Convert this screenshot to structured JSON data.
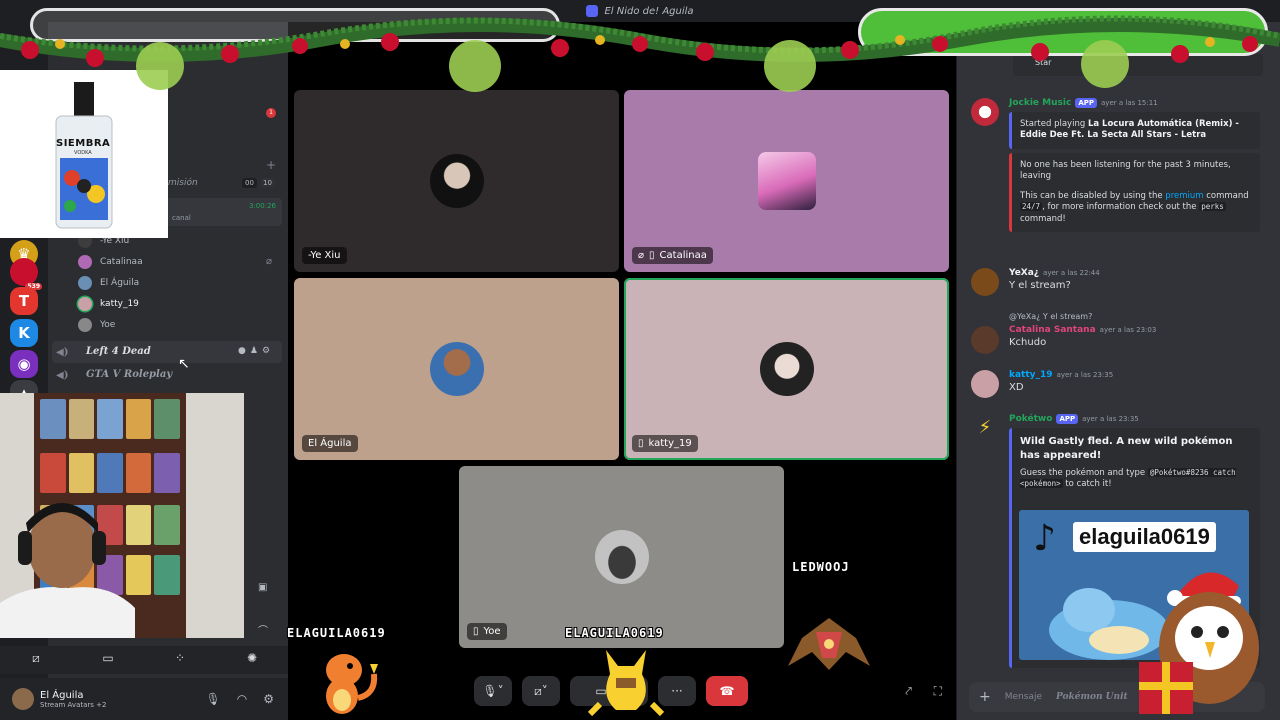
{
  "window": {
    "title": "El Nido de! Aguila"
  },
  "colors": {
    "accent": "#5865f2",
    "speaking": "#23a55a",
    "danger": "#da373c",
    "pink_tile": "#a97bab"
  },
  "sidebar": {
    "channel_partial": "misión",
    "stream_time": "3:00:26",
    "channel_caption": "canal",
    "counter_left": "00",
    "counter_right": "10",
    "notification_count": "1",
    "server_badge": "539",
    "voice_members": [
      {
        "name": "-Ye Xiu"
      },
      {
        "name": "Catalinaa"
      },
      {
        "name": "El Águila"
      },
      {
        "name": "katty_19"
      },
      {
        "name": "Yoe"
      }
    ],
    "voice_channels": [
      {
        "name": "Left 4 Dead"
      },
      {
        "name": "GTA V Roleplay"
      }
    ]
  },
  "product": {
    "brand": "SIEMBRA",
    "sub": "VODKA"
  },
  "user": {
    "name": "El Águila",
    "status": "Stream Avatars +2"
  },
  "tiles": {
    "ye_xiu": "-Ye Xiu",
    "catalina": "Catalinaa",
    "aguila": "El Águila",
    "katty": "katty_19",
    "yoe": "Yoe"
  },
  "overlay": {
    "label_left": "ELAGUILA0619",
    "label_center": "ELAGUILA0619",
    "label_right": "LEDWOOJ"
  },
  "chat": {
    "pinned_partial": "Star",
    "messages": [
      {
        "author": "Jockie Music",
        "badge": "APP",
        "time": "ayer a las 15:11",
        "embed": {
          "prefix": "Started playing",
          "song": "La Locura Automática (Remix) - Eddie Dee Ft. La Secta All Stars - Letra"
        }
      },
      {
        "embed2": {
          "line1": "No one has been listening for the past 3 minutes, leaving",
          "line2a": "This can be disabled by using the",
          "premium": "premium",
          "line2b": "command",
          "code": "24/7",
          "line2c": ", for more information check out the",
          "perks": "perks",
          "line2d": "command!"
        }
      },
      {
        "author": "YeXa¿",
        "time": "ayer a las 22:44",
        "text": "Y el stream?"
      },
      {
        "reply": "@YeXa¿ Y el stream?",
        "author": "Catalina Santana",
        "time": "ayer a las 23:03",
        "text": "Kchudo"
      },
      {
        "author": "katty_19",
        "time": "ayer a las 23:35",
        "text": "XD"
      },
      {
        "author": "Pokétwo",
        "badge": "APP",
        "time": "ayer a las 23:35",
        "embed": {
          "title": "Wild Gastly fled. A new wild pokémon has appeared!",
          "guess": "Guess the pokémon and type",
          "code": "@Pokétwo#8236 catch <pokémon>",
          "suffix": "to catch it!"
        }
      }
    ],
    "tiktok_handle": "elaguila0619",
    "input_placeholder": "Mensaje",
    "input_channel": "Pokémon Unit"
  }
}
